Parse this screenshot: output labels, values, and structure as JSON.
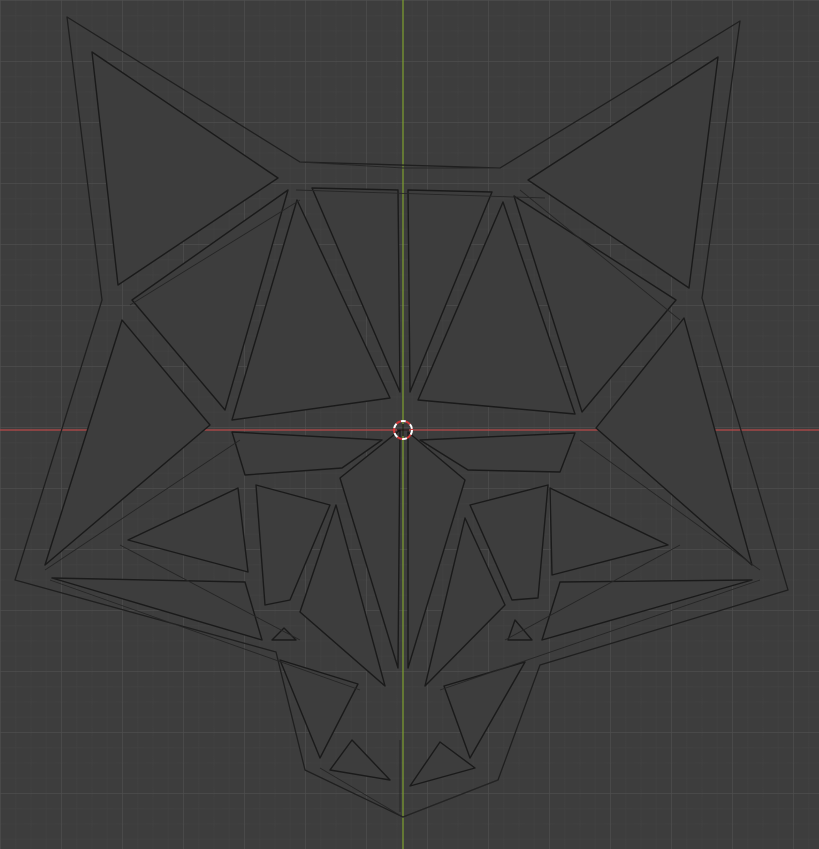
{
  "viewport": {
    "background_color": "#3d3d3d",
    "grid_minor_color": "#464646",
    "grid_major_color": "#505050",
    "axis_x_color": "#b84a4a",
    "axis_y_color": "#7ea12f"
  },
  "object": {
    "icon": "fox-head-mesh-icon",
    "face_color": "#3f3f3f",
    "edge_color": "#1f1f1f"
  },
  "cursor": {
    "icon": "3d-cursor-icon",
    "ring_colors": [
      "#ffffff",
      "#d43a3a"
    ]
  }
}
